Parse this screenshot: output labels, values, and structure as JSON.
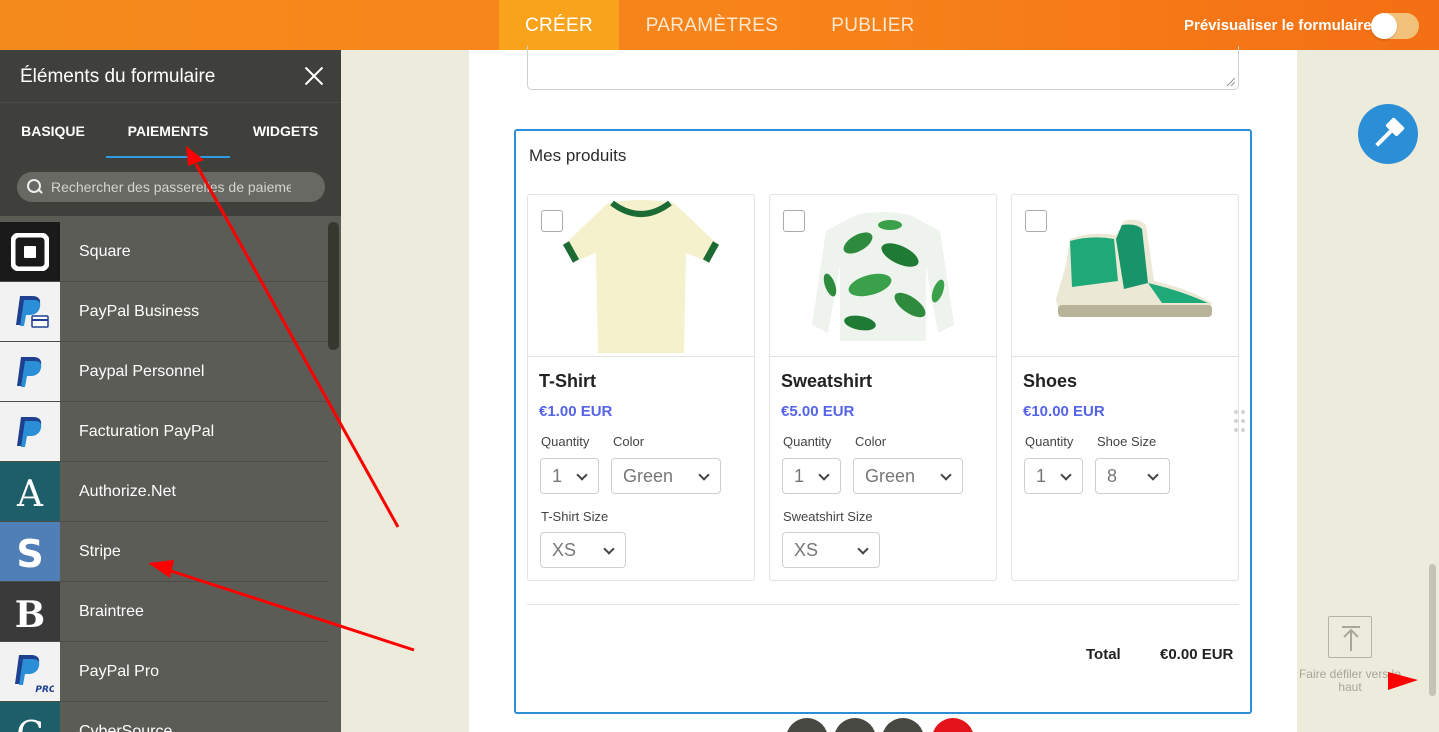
{
  "topbar": {
    "tabs": [
      "CRÉER",
      "PARAMÈTRES",
      "PUBLIER"
    ],
    "preview_label": "Prévisualiser le formulaire"
  },
  "sidebar": {
    "title": "Éléments du formulaire",
    "tabs": [
      "BASIQUE",
      "PAIEMENTS",
      "WIDGETS"
    ],
    "search_placeholder": "Rechercher des passerelles de paiement",
    "gateways": [
      {
        "label": "Square",
        "icon": "square-logo-icon",
        "color": "#1a1a1a"
      },
      {
        "label": "PayPal Business",
        "icon": "paypal-business-icon",
        "color": "#f2f2f2"
      },
      {
        "label": "Paypal Personnel",
        "icon": "paypal-icon",
        "color": "#f2f2f2"
      },
      {
        "label": "Facturation PayPal",
        "icon": "paypal-icon",
        "color": "#f2f2f2"
      },
      {
        "label": "Authorize.Net",
        "icon": "authorize-net-icon",
        "color": "#1e5e68"
      },
      {
        "label": "Stripe",
        "icon": "stripe-icon",
        "color": "#4f7fb6"
      },
      {
        "label": "Braintree",
        "icon": "braintree-icon",
        "color": "#3a3a3a"
      },
      {
        "label": "PayPal Pro",
        "icon": "paypal-pro-icon",
        "color": "#f2f2f2"
      },
      {
        "label": "CyberSource",
        "icon": "cybersource-icon",
        "color": "#1e5e68"
      }
    ]
  },
  "form": {
    "products_title": "Mes produits",
    "products": [
      {
        "name": "T-Shirt",
        "price": "€1.00 EUR",
        "image": "tshirt-image",
        "options": [
          {
            "label": "Quantity",
            "value": "1"
          },
          {
            "label": "Color",
            "value": "Green"
          },
          {
            "label": "T-Shirt Size",
            "value": "XS"
          }
        ]
      },
      {
        "name": "Sweatshirt",
        "price": "€5.00 EUR",
        "image": "sweatshirt-image",
        "options": [
          {
            "label": "Quantity",
            "value": "1"
          },
          {
            "label": "Color",
            "value": "Green"
          },
          {
            "label": "Sweatshirt Size",
            "value": "XS"
          }
        ]
      },
      {
        "name": "Shoes",
        "price": "€10.00 EUR",
        "image": "shoes-image",
        "options": [
          {
            "label": "Quantity",
            "value": "1"
          },
          {
            "label": "Shoe Size",
            "value": "8"
          }
        ]
      }
    ],
    "total_label": "Total",
    "total_value": "€0.00 EUR"
  },
  "scroll_top": {
    "label": "Faire défiler vers le haut"
  },
  "colors": {
    "accent_orange": "#f7821a",
    "accent_blue": "#2f8fd6",
    "price_purple": "#5563e8",
    "arrow_red": "#ff0000"
  }
}
